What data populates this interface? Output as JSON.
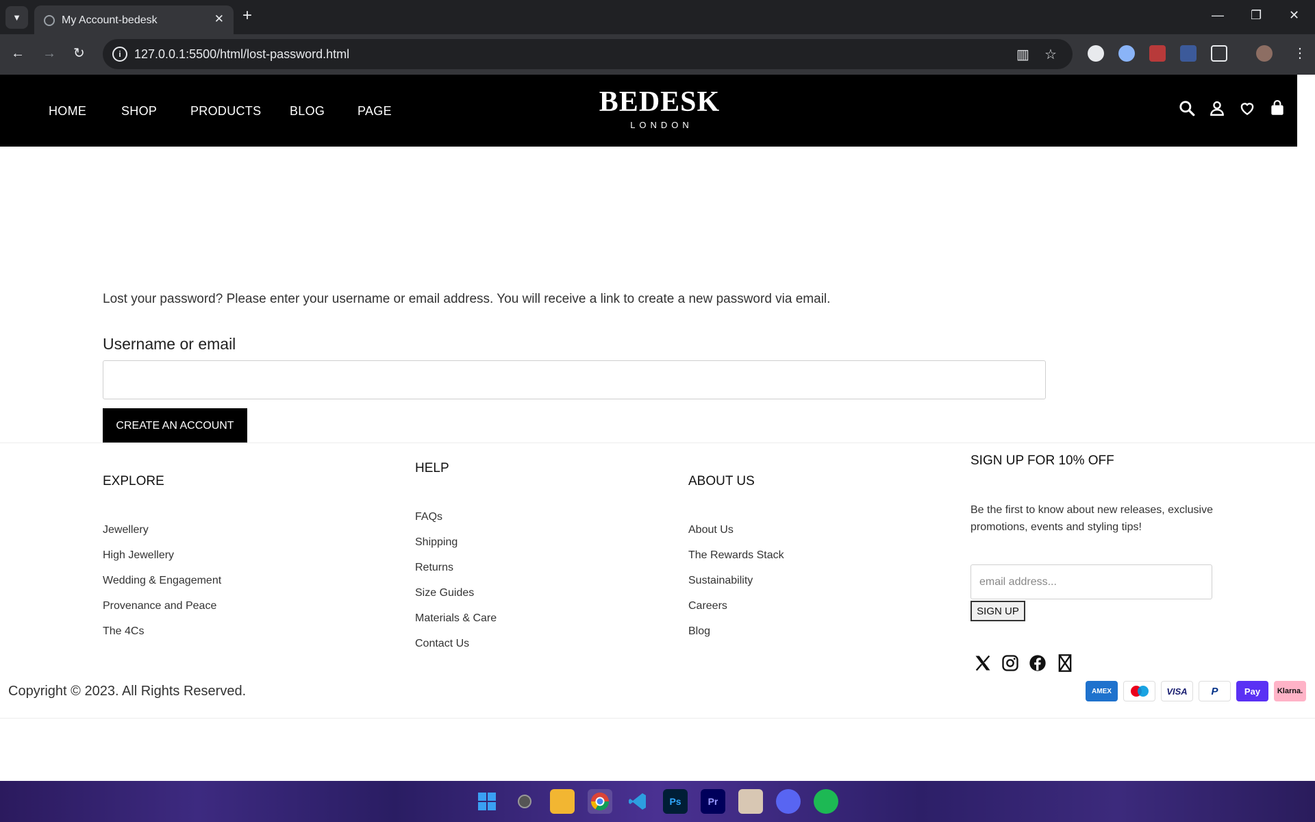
{
  "browser": {
    "tab_title": "My Account-bedesk",
    "url": "127.0.0.1:5500/html/lost-password.html"
  },
  "header": {
    "menu": [
      "HOME",
      "SHOP",
      "PRODUCTS",
      "BLOG",
      "PAGE"
    ],
    "logo_main": "BEDESK",
    "logo_sub": "LONDON"
  },
  "main": {
    "intro": "Lost your password? Please enter your username or email address. You will receive a link to create a new password via email.",
    "field_label": "Username or email",
    "field_value": "",
    "button_label": "CREATE AN ACCOUNT"
  },
  "footer": {
    "explore": {
      "title": "EXPLORE",
      "links": [
        "Jewellery",
        "High Jewellery",
        "Wedding & Engagement",
        "Provenance and Peace",
        "The 4Cs"
      ]
    },
    "help": {
      "title": "HELP",
      "links": [
        "FAQs",
        "Shipping",
        "Returns",
        "Size Guides",
        "Materials & Care",
        "Contact Us"
      ]
    },
    "about": {
      "title": "ABOUT US",
      "links": [
        "About Us",
        "The Rewards Stack",
        "Sustainability",
        "Careers",
        "Blog"
      ]
    },
    "signup": {
      "title": "SIGN UP FOR 10% OFF",
      "text": "Be the first to know about new releases, exclusive promotions, events and styling tips!",
      "placeholder": "email address...",
      "button": "SIGN UP"
    },
    "social_icons": [
      "x-icon",
      "instagram-icon",
      "facebook-icon",
      "x-box-icon"
    ],
    "copyright": "Copyright © 2023. All Rights Reserved.",
    "payments": [
      {
        "label": "AMEX",
        "color": "#1f72cd"
      },
      {
        "label": "",
        "color": "#ffffff"
      },
      {
        "label": "VISA",
        "color": "#ffffff"
      },
      {
        "label": "P",
        "color": "#ffffff"
      },
      {
        "label": "Pay",
        "color": "#5a31f4"
      },
      {
        "label": "Klarna.",
        "color": "#ffb3c7"
      }
    ]
  },
  "colors": {
    "header_bg": "#000000",
    "button_bg": "#000000"
  }
}
